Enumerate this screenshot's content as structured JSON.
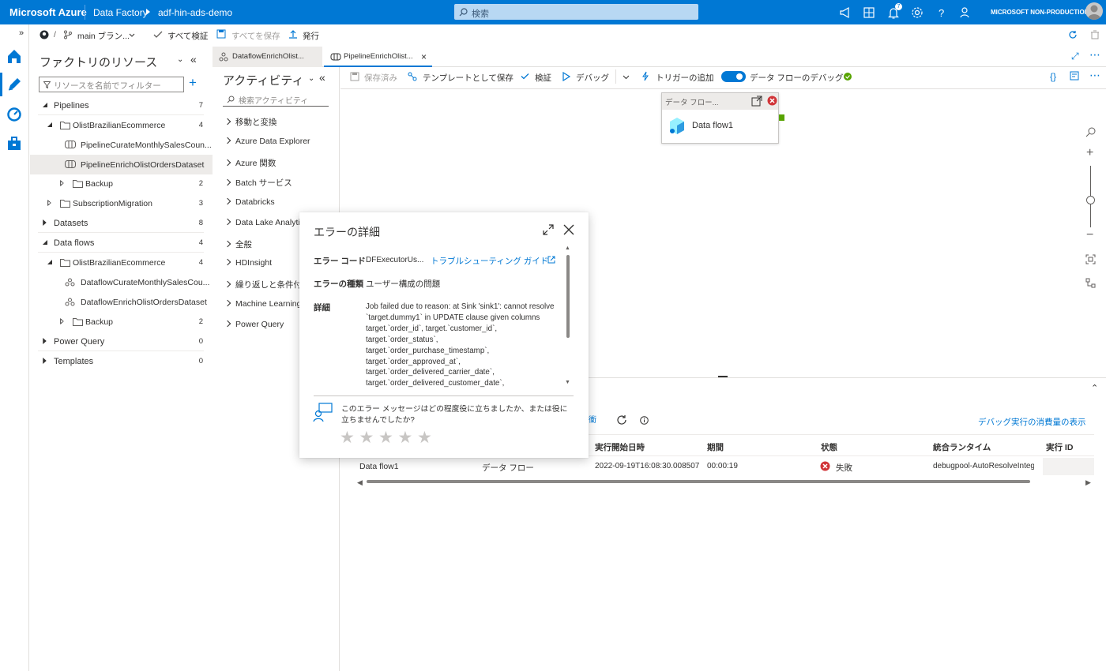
{
  "topbar": {
    "brand": "Microsoft Azure",
    "crumb1": "Data Factory",
    "crumb2": "adf-hin-ads-demo",
    "search_placeholder": "検索",
    "notification_count": "7",
    "tenant": "MICROSOFT NON-PRODUCTION",
    "bg_color": "#0078d4"
  },
  "toolbar": {
    "branch": "main ブラン...",
    "validate_all": "すべて検証",
    "save_all": "すべてを保存",
    "publish": "発行"
  },
  "resources": {
    "title": "ファクトリのリソース",
    "filter_placeholder": "リソースを名前でフィルター",
    "items": [
      {
        "label": "Pipelines",
        "count": "7"
      },
      {
        "label": "OlistBrazilianEcommerce",
        "count": "4"
      },
      {
        "label": "PipelineCurateMonthlySalesCoun...",
        "count": ""
      },
      {
        "label": "PipelineEnrichOlistOrdersDataset",
        "count": ""
      },
      {
        "label": "Backup",
        "count": "2"
      },
      {
        "label": "SubscriptionMigration",
        "count": "3"
      },
      {
        "label": "Datasets",
        "count": "8"
      },
      {
        "label": "Data flows",
        "count": "4"
      },
      {
        "label": "OlistBrazilianEcommerce",
        "count": "4"
      },
      {
        "label": "DataflowCurateMonthlySalesCou...",
        "count": ""
      },
      {
        "label": "DataflowEnrichOlistOrdersDataset",
        "count": ""
      },
      {
        "label": "Backup",
        "count": "2"
      },
      {
        "label": "Power Query",
        "count": "0"
      },
      {
        "label": "Templates",
        "count": "0"
      }
    ]
  },
  "activities": {
    "title": "アクティビティ",
    "search_placeholder": "検索アクティビティ",
    "items": [
      "移動と変換",
      "Azure Data Explorer",
      "Azure 関数",
      "Batch サービス",
      "Databricks",
      "Data Lake Analytic",
      "全般",
      "HDInsight",
      "繰り返しと条件付き",
      "Machine Learning",
      "Power Query"
    ]
  },
  "tabs": [
    {
      "label": "DataflowEnrichOlist..."
    },
    {
      "label": "PipelineEnrichOlist..."
    }
  ],
  "pipeline_toolbar": {
    "saved": "保存済み",
    "save_as_template": "テンプレートとして保存",
    "validate": "検証",
    "debug": "デバッグ",
    "add_trigger": "トリガーの追加",
    "dataflow_debug": "データ フローのデバッグ"
  },
  "node": {
    "header": "データ フロー",
    "name": "Data flow1"
  },
  "output": {
    "consumption_link": "デバッグ実行の消費量の表示",
    "columns": [
      "実行開始日時",
      "期間",
      "状態",
      "統合ランタイム",
      "実行 ID"
    ],
    "row": {
      "name": "Data flow1",
      "type": "データ フロー",
      "start": "2022-09-19T16:08:30.008507",
      "duration": "00:00:19",
      "status": "失敗",
      "runtime": "debugpool-AutoResolveInteg"
    }
  },
  "dialog": {
    "title": "エラーの詳細",
    "code_label": "エラー コード",
    "code_value": "DFExecutorUs...",
    "troubleshoot_link": "トラブルシューティング ガイド",
    "type_label": "エラーの種類",
    "type_value": "ユーザー構成の問題",
    "detail_label": "詳細",
    "detail_lines": [
      "Job failed due to reason: at Sink 'sink1': cannot resolve",
      "`target.dummy1` in UPDATE clause given columns",
      "target.`order_id`, target.`customer_id`,",
      "target.`order_status`,",
      "target.`order_purchase_timestamp`,",
      "target.`order_approved_at`,",
      "target.`order_delivered_carrier_date`,",
      "target.`order_delivered_customer_date`,"
    ],
    "feedback_line1": "このエラー メッセージはどの程度役に立ちましたか、または役に",
    "feedback_line2": "立ちませんでしたか?",
    "stars": 5
  }
}
